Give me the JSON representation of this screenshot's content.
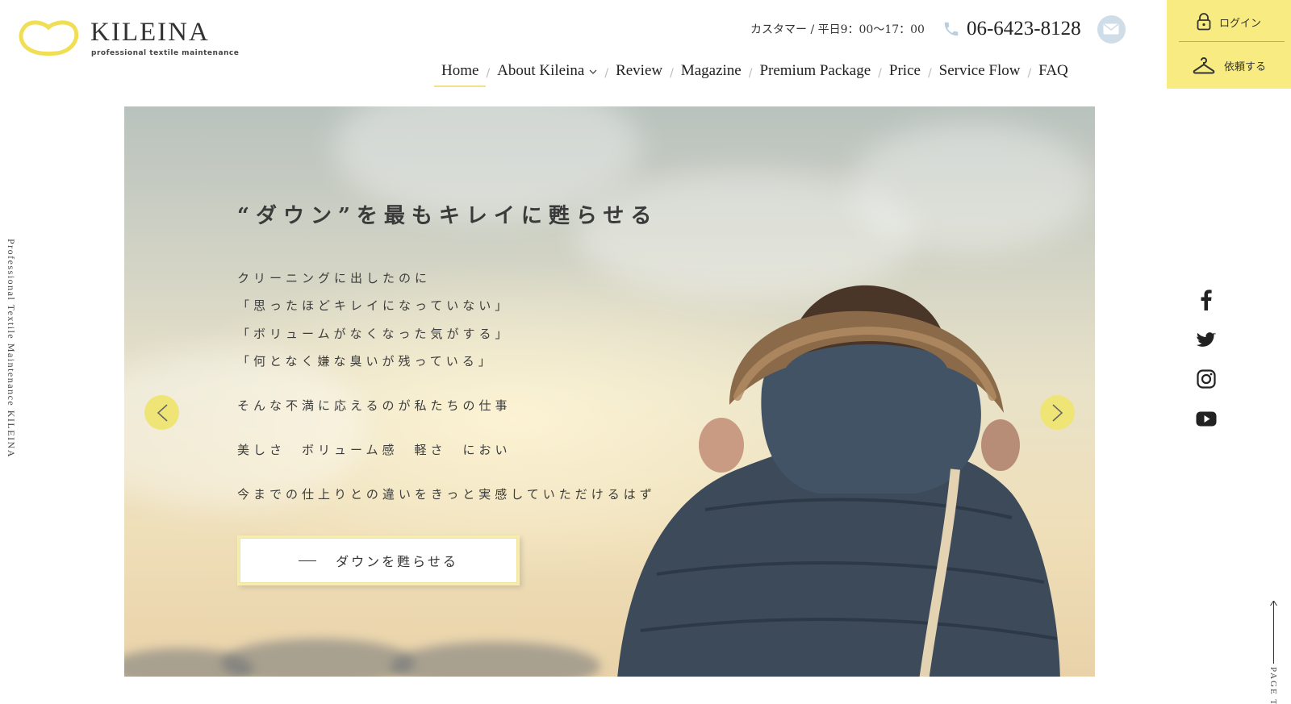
{
  "brand": {
    "name": "KILEINA",
    "tagline": "professional textile maintenance",
    "accent": "#f7eb82"
  },
  "contact": {
    "hours": "カスタマー / 平日9：00〜17：00",
    "phone": "06-6423-8128",
    "mail_icon": "mail-icon"
  },
  "nav": {
    "items": [
      {
        "label": "Home",
        "active": true
      },
      {
        "label": "About Kileina",
        "dropdown": true
      },
      {
        "label": "Review"
      },
      {
        "label": "Magazine"
      },
      {
        "label": "Premium Package"
      },
      {
        "label": "Price"
      },
      {
        "label": "Service Flow"
      },
      {
        "label": "FAQ"
      }
    ],
    "separator": "/"
  },
  "side_actions": {
    "login_label": "ログイン",
    "request_label": "依頼する"
  },
  "side_text": "Professional Textile Maintenance KILEINA",
  "page_top": "PAGE TOP",
  "social": [
    "facebook-icon",
    "twitter-icon",
    "instagram-icon",
    "youtube-icon"
  ],
  "hero": {
    "headline": "“ダウン”を最もキレイに甦らせる",
    "lines": [
      "クリーニングに出したのに",
      "「思ったほどキレイになっていない」",
      "「ボリュームがなくなった気がする」",
      "「何となく嫌な臭いが残っている」",
      "そんな不満に応えるのが私たちの仕事",
      "美しさ　ボリューム感　軽さ　におい",
      "今までの仕上りとの違いをきっと実感していただけるはず"
    ],
    "cta_label": "ダウンを甦らせる"
  }
}
